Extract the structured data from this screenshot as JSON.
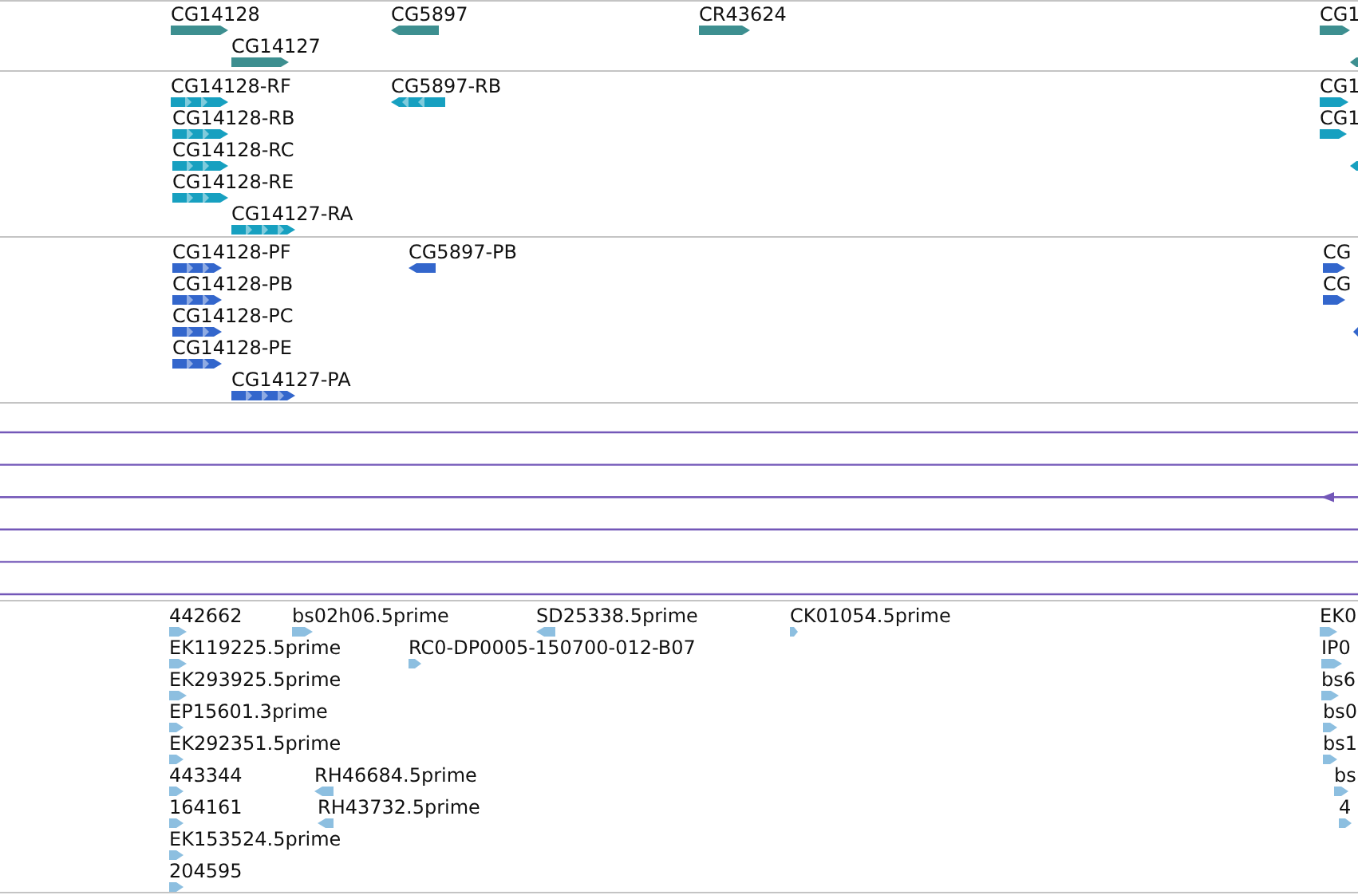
{
  "tracks": [
    {
      "kind": "gene",
      "color": "#3d8f90",
      "features": [
        {
          "label": "CG14128",
          "reverse": false
        },
        {
          "label": "CG14127",
          "reverse": false
        },
        {
          "label": "CG5897",
          "reverse": true
        },
        {
          "label": "CR43624",
          "reverse": false
        },
        {
          "label": "CG1",
          "reverse": false
        },
        {
          "reverse": true
        }
      ]
    },
    {
      "kind": "transcript",
      "color": "#17a0c0",
      "features": [
        {
          "label": "CG14128-RF",
          "reverse": false
        },
        {
          "label": "CG14128-RB",
          "reverse": false
        },
        {
          "label": "CG14128-RC",
          "reverse": false
        },
        {
          "label": "CG14128-RE",
          "reverse": false
        },
        {
          "label": "CG14127-RA",
          "reverse": false
        },
        {
          "label": "CG5897-RB",
          "reverse": true
        },
        {
          "label": "CG1",
          "reverse": false
        },
        {
          "label": "CG1",
          "reverse": false
        },
        {
          "reverse": true
        }
      ]
    },
    {
      "kind": "transcript",
      "color": "#3366cc",
      "features": [
        {
          "label": "CG14128-PF",
          "reverse": false
        },
        {
          "label": "CG14128-PB",
          "reverse": false
        },
        {
          "label": "CG14128-PC",
          "reverse": false
        },
        {
          "label": "CG14128-PE",
          "reverse": false
        },
        {
          "label": "CG14127-PA",
          "reverse": false
        },
        {
          "label": "CG5897-PB",
          "reverse": true
        },
        {
          "label": "CG",
          "reverse": false
        },
        {
          "label": "CG",
          "reverse": false
        },
        {
          "reverse": true
        }
      ]
    },
    {
      "kind": "alignment",
      "color": "#7357b8"
    },
    {
      "kind": "gene",
      "color": "#8dbfe0",
      "features": [
        {
          "label": "442662",
          "reverse": false
        },
        {
          "label": "bs02h06.5prime",
          "reverse": false
        },
        {
          "label": "SD25338.5prime",
          "reverse": true
        },
        {
          "label": "CK01054.5prime",
          "reverse": false
        },
        {
          "label": "EK0",
          "reverse": false
        },
        {
          "label": "EK119225.5prime",
          "reverse": false
        },
        {
          "label": "RC0-DP0005-150700-012-B07",
          "reverse": false
        },
        {
          "label": "IP0",
          "reverse": false
        },
        {
          "label": "EK293925.5prime",
          "reverse": false
        },
        {
          "label": "bs6",
          "reverse": false
        },
        {
          "label": "EP15601.3prime",
          "reverse": false
        },
        {
          "label": "bs0",
          "reverse": false
        },
        {
          "label": "EK292351.5prime",
          "reverse": false
        },
        {
          "label": "bs1",
          "reverse": false
        },
        {
          "label": "443344",
          "reverse": false
        },
        {
          "label": "RH46684.5prime",
          "reverse": true
        },
        {
          "label": "bs",
          "reverse": false
        },
        {
          "label": "164161",
          "reverse": false
        },
        {
          "label": "RH43732.5prime",
          "reverse": true
        },
        {
          "label": "4",
          "reverse": false
        },
        {
          "label": "EK153524.5prime",
          "reverse": false
        },
        {
          "label": "204595",
          "reverse": false
        }
      ]
    }
  ]
}
